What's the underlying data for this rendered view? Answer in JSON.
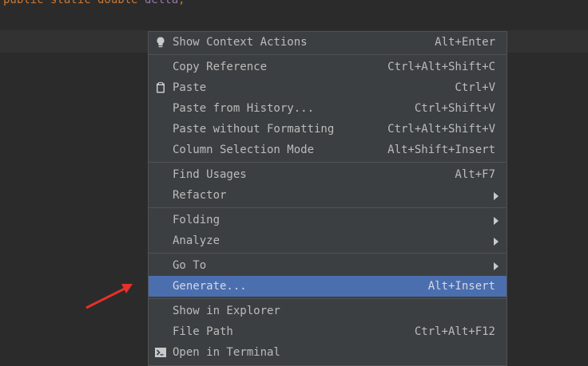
{
  "editor": {
    "code_keywords": "public static double",
    "code_ident": "delta",
    "code_punct": ";"
  },
  "menu": {
    "items": [
      {
        "label": "Show Context Actions",
        "shortcut": "Alt+Enter",
        "icon": "lightbulb-icon"
      },
      {
        "label": "Copy Reference",
        "shortcut": "Ctrl+Alt+Shift+C"
      },
      {
        "label": "Paste",
        "shortcut": "Ctrl+V",
        "icon": "clipboard-icon"
      },
      {
        "label": "Paste from History...",
        "shortcut": "Ctrl+Shift+V"
      },
      {
        "label": "Paste without Formatting",
        "shortcut": "Ctrl+Alt+Shift+V"
      },
      {
        "label": "Column Selection Mode",
        "shortcut": "Alt+Shift+Insert"
      },
      {
        "label": "Find Usages",
        "shortcut": "Alt+F7"
      },
      {
        "label": "Refactor",
        "submenu": true
      },
      {
        "label": "Folding",
        "submenu": true
      },
      {
        "label": "Analyze",
        "submenu": true
      },
      {
        "label": "Go To",
        "submenu": true
      },
      {
        "label": "Generate...",
        "shortcut": "Alt+Insert",
        "selected": true
      },
      {
        "label": "Show in Explorer"
      },
      {
        "label": "File Path",
        "shortcut": "Ctrl+Alt+F12"
      },
      {
        "label": "Open in Terminal",
        "icon": "terminal-icon"
      }
    ]
  },
  "colors": {
    "background": "#2b2b2b",
    "menu_bg": "#3c3f41",
    "selection": "#4b6eaf",
    "annotation_arrow": "#e8302a"
  }
}
